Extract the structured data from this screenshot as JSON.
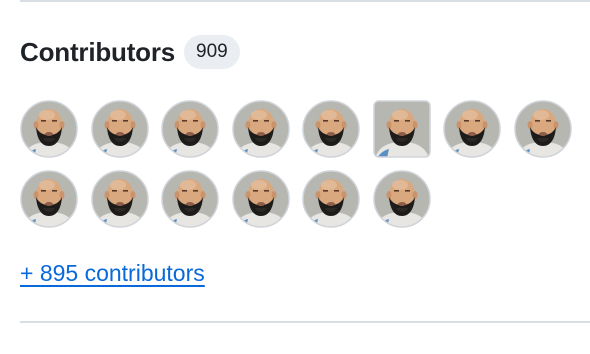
{
  "contributors": {
    "title": "Contributors",
    "count": "909",
    "avatar_count": 14,
    "avatar_columns": 8,
    "square_avatar_index": 5,
    "more_link": "+ 895 contributors"
  },
  "colors": {
    "link": "#0969da",
    "text": "#1f2328",
    "counter_bg": "#eaeef2",
    "divider": "#d8dee4"
  },
  "icons": {
    "avatar": "bearded-man-avatar-image"
  }
}
